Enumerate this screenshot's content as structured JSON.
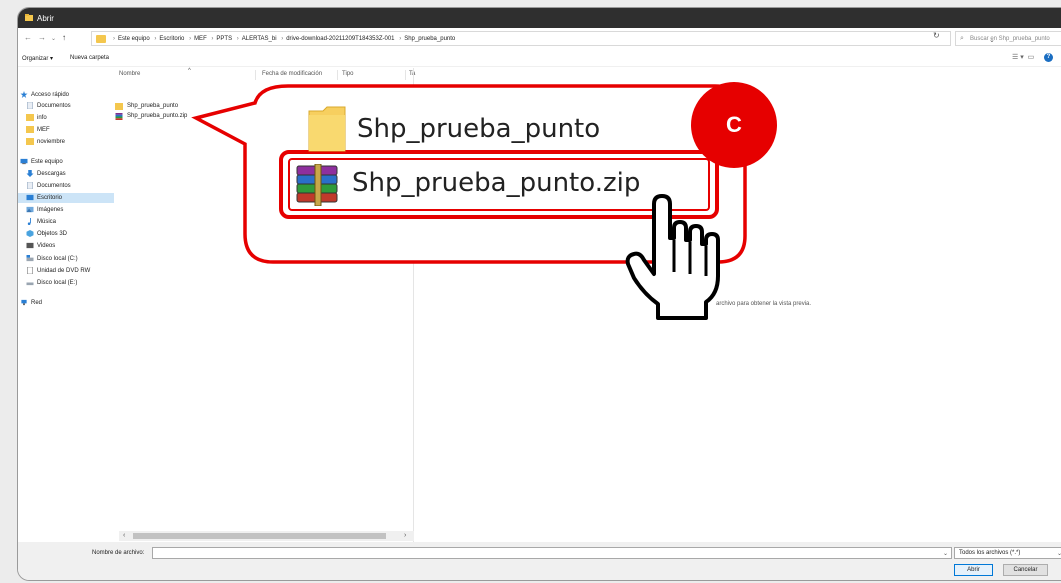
{
  "window": {
    "title": "Abrir"
  },
  "address": {
    "breadcrumb": [
      "Este equipo",
      "Escritorio",
      "MEF",
      "PPTS",
      "ALERTAS_bi",
      "drive-download-20211209T184353Z-001",
      "Shp_prueba_punto"
    ],
    "search_placeholder": "Buscar en Shp_prueba_punto"
  },
  "toolbar": {
    "organize_label": "Organizar ▾",
    "new_folder_label": "Nueva carpeta"
  },
  "sidebar": {
    "items": [
      {
        "label": "Acceso rápido",
        "icon": "star-icon"
      },
      {
        "label": "Documentos",
        "icon": "documents-icon"
      },
      {
        "label": "info",
        "icon": "folder-icon"
      },
      {
        "label": "MEF",
        "icon": "folder-icon"
      },
      {
        "label": "noviembre",
        "icon": "folder-icon"
      },
      {
        "label": "Este equipo",
        "icon": "computer-icon"
      },
      {
        "label": "Descargas",
        "icon": "download-icon"
      },
      {
        "label": "Documentos",
        "icon": "documents-icon"
      },
      {
        "label": "Escritorio",
        "icon": "desktop-icon"
      },
      {
        "label": "Imágenes",
        "icon": "pictures-icon"
      },
      {
        "label": "Música",
        "icon": "music-icon"
      },
      {
        "label": "Objetos 3D",
        "icon": "objects3d-icon"
      },
      {
        "label": "Videos",
        "icon": "videos-icon"
      },
      {
        "label": "Disco local (C:)",
        "icon": "drive-icon"
      },
      {
        "label": "Unidad de DVD RW",
        "icon": "dvd-icon"
      },
      {
        "label": "Disco local (E:)",
        "icon": "drive-icon"
      },
      {
        "label": "Red",
        "icon": "network-icon"
      }
    ]
  },
  "filelist": {
    "columns": [
      "Nombre",
      "Fecha de modificación",
      "Tipo",
      "Ta"
    ],
    "files": [
      {
        "name": "Shp_prueba_punto",
        "icon": "folder-icon"
      },
      {
        "name": "Shp_prueba_punto.zip",
        "icon": "winrar-icon"
      }
    ]
  },
  "preview": {
    "message": "archivo para obtener la vista previa."
  },
  "bottom": {
    "filename_label": "Nombre de archivo:",
    "filename_value": "",
    "filetype": "Todos los archivos (*.*)",
    "open_label": "Abrir",
    "cancel_label": "Cancelar"
  },
  "callout": {
    "badge": "C",
    "folder_name": "Shp_prueba_punto",
    "zip_name": "Shp_prueba_punto.zip"
  },
  "colors": {
    "accent_red": "#e60000",
    "folder_yellow": "#f4c74e",
    "selection_blue": "#cce4f7",
    "titlebar": "#2f2f2f"
  }
}
